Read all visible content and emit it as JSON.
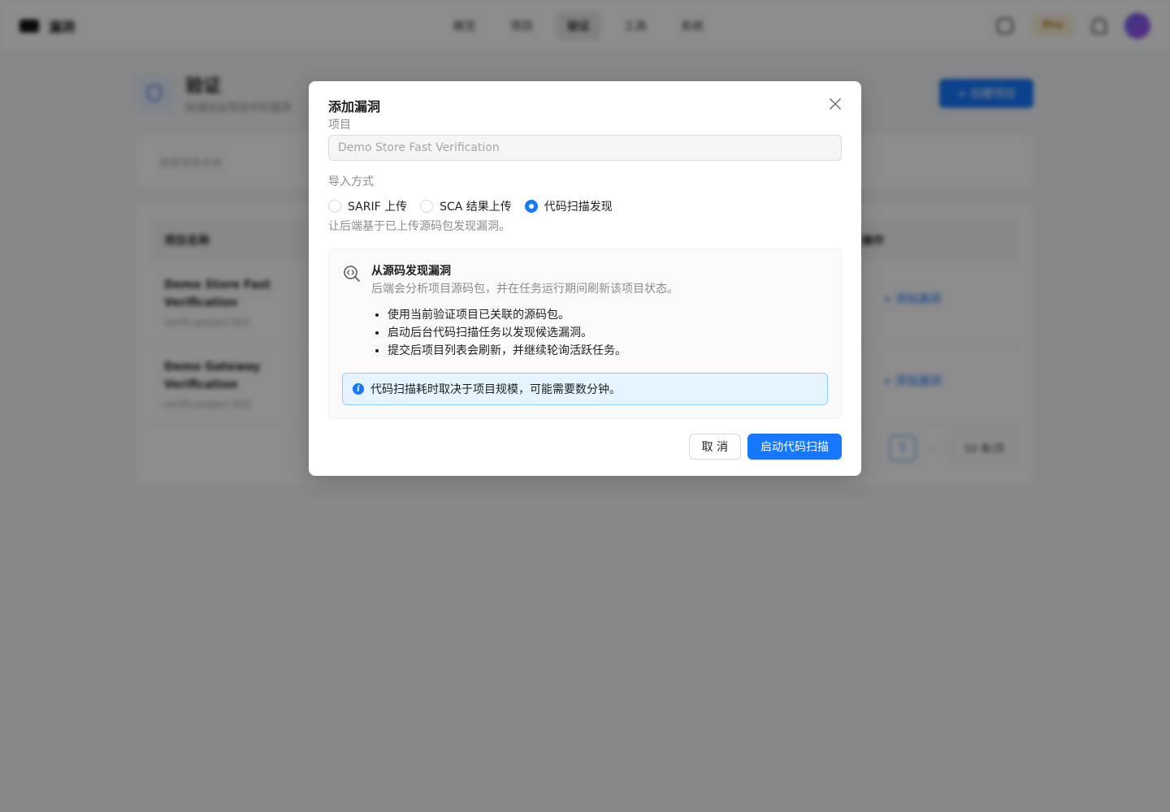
{
  "app": {
    "brand": "漏洞",
    "nav": [
      "概览",
      "项目",
      "验证",
      "工具",
      "系统"
    ],
    "nav_active_index": 2,
    "pro_badge": "Pro",
    "page_title": "验证",
    "page_subtitle": "快速验证项目中的漏洞",
    "create_button": "+ 创建项目",
    "search_placeholder": "搜索项目名称",
    "table": {
      "headers": [
        "项目名称",
        "操作"
      ],
      "rows": [
        {
          "name": "Demo Store Fast Verification",
          "id": "verify-project-001",
          "op": "+ 添加漏洞"
        },
        {
          "name": "Demo Gateway Verification",
          "id": "verify-project-002",
          "op": "+ 添加漏洞"
        }
      ],
      "page": "1",
      "page_size": "10 条/页"
    }
  },
  "modal": {
    "title": "添加漏洞",
    "project_label": "项目",
    "project_value": "Demo Store Fast Verification",
    "import_label": "导入方式",
    "import_options": [
      {
        "label": "SARIF 上传",
        "checked": false
      },
      {
        "label": "SCA 结果上传",
        "checked": false
      },
      {
        "label": "代码扫描发现",
        "checked": true
      }
    ],
    "import_help": "让后端基于已上传源码包发现漏洞。",
    "panel": {
      "title": "从源码发现漏洞",
      "description": "后端会分析项目源码包，并在任务运行期间刷新该项目状态。",
      "items": [
        "使用当前验证项目已关联的源码包。",
        "启动后台代码扫描任务以发现候选漏洞。",
        "提交后项目列表会刷新，并继续轮询活跃任务。"
      ],
      "alert": "代码扫描耗时取决于项目规模，可能需要数分钟。"
    },
    "cancel_button": "取 消",
    "submit_button": "启动代码扫描"
  },
  "colors": {
    "primary": "#1677ff",
    "overlay": "rgba(0,0,0,0.45)",
    "alert_bg": "#e6f4ff",
    "alert_border": "#91caff"
  }
}
